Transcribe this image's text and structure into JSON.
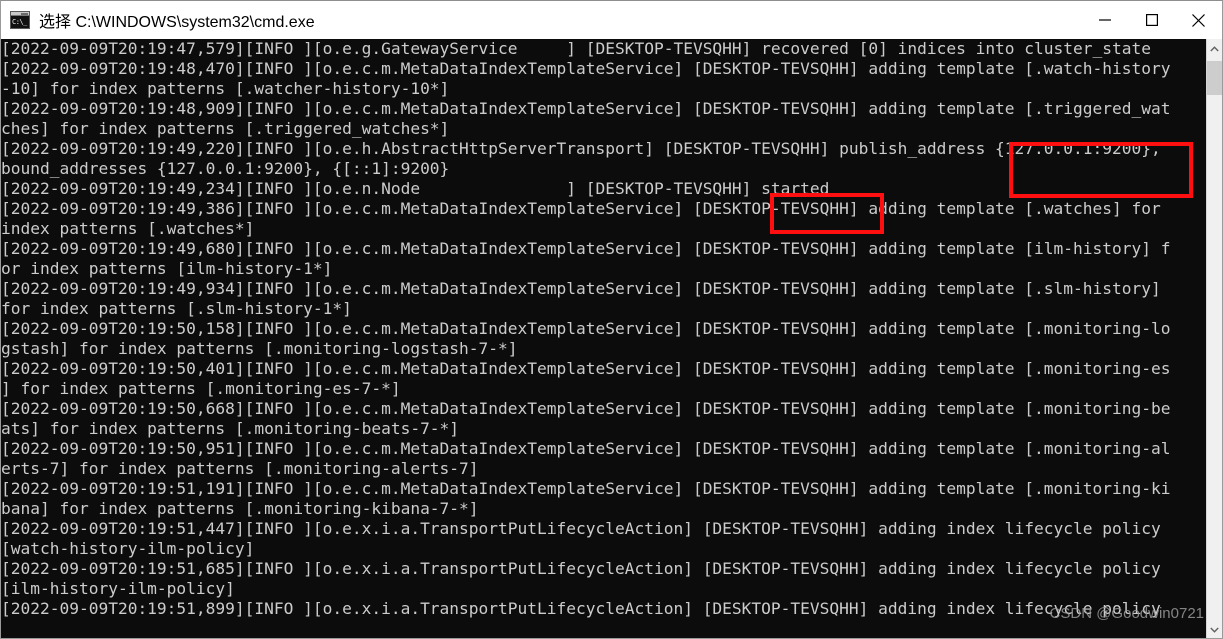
{
  "window": {
    "title": "选择 C:\\WINDOWS\\system32\\cmd.exe",
    "icon_name": "cmd-icon",
    "icon_glyph": "C:\\_",
    "controls": {
      "minimize_label": "Minimize",
      "maximize_label": "Maximize",
      "close_label": "Close"
    },
    "background_color": "#0c0c0c",
    "text_color": "#cccccc",
    "titlebar_color": "#ffffff"
  },
  "console": {
    "lines": [
      "[2022-09-09T20:19:47,579][INFO ][o.e.g.GatewayService     ] [DESKTOP-TEVSQHH] recovered [0] indices into cluster_state",
      "[2022-09-09T20:19:48,470][INFO ][o.e.c.m.MetaDataIndexTemplateService] [DESKTOP-TEVSQHH] adding template [.watch-history",
      "-10] for index patterns [.watcher-history-10*]",
      "[2022-09-09T20:19:48,909][INFO ][o.e.c.m.MetaDataIndexTemplateService] [DESKTOP-TEVSQHH] adding template [.triggered_wat",
      "ches] for index patterns [.triggered_watches*]",
      "[2022-09-09T20:19:49,220][INFO ][o.e.h.AbstractHttpServerTransport] [DESKTOP-TEVSQHH] publish_address {127.0.0.1:9200},",
      "bound_addresses {127.0.0.1:9200}, {[::1]:9200}",
      "[2022-09-09T20:19:49,234][INFO ][o.e.n.Node               ] [DESKTOP-TEVSQHH] started",
      "[2022-09-09T20:19:49,386][INFO ][o.e.c.m.MetaDataIndexTemplateService] [DESKTOP-TEVSQHH] adding template [.watches] for",
      "index patterns [.watches*]",
      "[2022-09-09T20:19:49,680][INFO ][o.e.c.m.MetaDataIndexTemplateService] [DESKTOP-TEVSQHH] adding template [ilm-history] f",
      "or index patterns [ilm-history-1*]",
      "[2022-09-09T20:19:49,934][INFO ][o.e.c.m.MetaDataIndexTemplateService] [DESKTOP-TEVSQHH] adding template [.slm-history]",
      "for index patterns [.slm-history-1*]",
      "[2022-09-09T20:19:50,158][INFO ][o.e.c.m.MetaDataIndexTemplateService] [DESKTOP-TEVSQHH] adding template [.monitoring-lo",
      "gstash] for index patterns [.monitoring-logstash-7-*]",
      "[2022-09-09T20:19:50,401][INFO ][o.e.c.m.MetaDataIndexTemplateService] [DESKTOP-TEVSQHH] adding template [.monitoring-es",
      "] for index patterns [.monitoring-es-7-*]",
      "[2022-09-09T20:19:50,668][INFO ][o.e.c.m.MetaDataIndexTemplateService] [DESKTOP-TEVSQHH] adding template [.monitoring-be",
      "ats] for index patterns [.monitoring-beats-7-*]",
      "[2022-09-09T20:19:50,951][INFO ][o.e.c.m.MetaDataIndexTemplateService] [DESKTOP-TEVSQHH] adding template [.monitoring-al",
      "erts-7] for index patterns [.monitoring-alerts-7]",
      "[2022-09-09T20:19:51,191][INFO ][o.e.c.m.MetaDataIndexTemplateService] [DESKTOP-TEVSQHH] adding template [.monitoring-ki",
      "bana] for index patterns [.monitoring-kibana-7-*]",
      "[2022-09-09T20:19:51,447][INFO ][o.e.x.i.a.TransportPutLifecycleAction] [DESKTOP-TEVSQHH] adding index lifecycle policy",
      "[watch-history-ilm-policy]",
      "[2022-09-09T20:19:51,685][INFO ][o.e.x.i.a.TransportPutLifecycleAction] [DESKTOP-TEVSQHH] adding index lifecycle policy",
      "[ilm-history-ilm-policy]",
      "[2022-09-09T20:19:51,899][INFO ][o.e.x.i.a.TransportPutLifecycleAction] [DESKTOP-TEVSQHH] adding index lifecycle policy"
    ]
  },
  "annotations": {
    "color": "#ff0f0f",
    "boxes": [
      {
        "name": "publish-address",
        "text": "{127.0.0.1:9200},"
      },
      {
        "name": "node-started",
        "text": "started"
      }
    ]
  },
  "scrollbar": {
    "up_arrow": "▲",
    "down_arrow": "▼",
    "thumb_color": "#cdcdcd",
    "track_color": "#f0f0f0"
  },
  "watermark": {
    "text": "CSDN @Goodwin0721"
  }
}
